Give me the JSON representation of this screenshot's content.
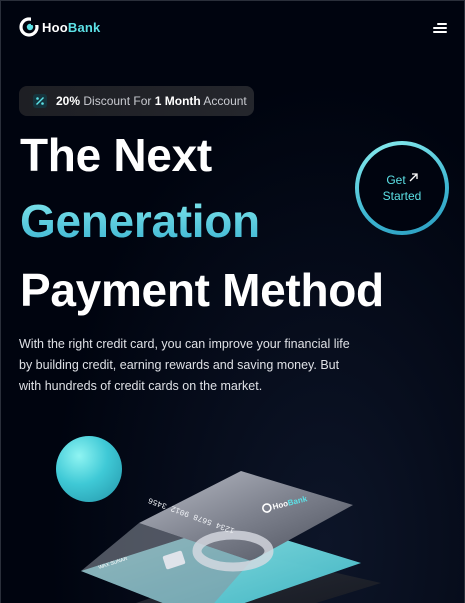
{
  "header": {
    "logo_hoo": "Hoo",
    "logo_bank": "Bank",
    "menu_icon": "hamburger-menu-icon"
  },
  "promo": {
    "icon": "discount-icon",
    "percent": "20%",
    "text_mid": " Discount For ",
    "duration": "1 Month",
    "text_end": " Account"
  },
  "hero": {
    "line1": "The Next",
    "line2": "Generation",
    "line3": "Payment Method",
    "description": "With the right credit card, you can improve your financial life by building credit, earning rewards and saving money. But with hundreds of credit cards on the market."
  },
  "cta": {
    "line1": "Get",
    "line2": "Started",
    "icon": "arrow-up-right-icon"
  },
  "card": {
    "number": "1234 5678 9012 3456",
    "holder": "WAX SUNAR",
    "brand_hoo": "Hoo",
    "brand_bank": "Bank"
  },
  "colors": {
    "background": "#00040f",
    "accent": "#5ce1e6",
    "text": "#ffffff"
  }
}
